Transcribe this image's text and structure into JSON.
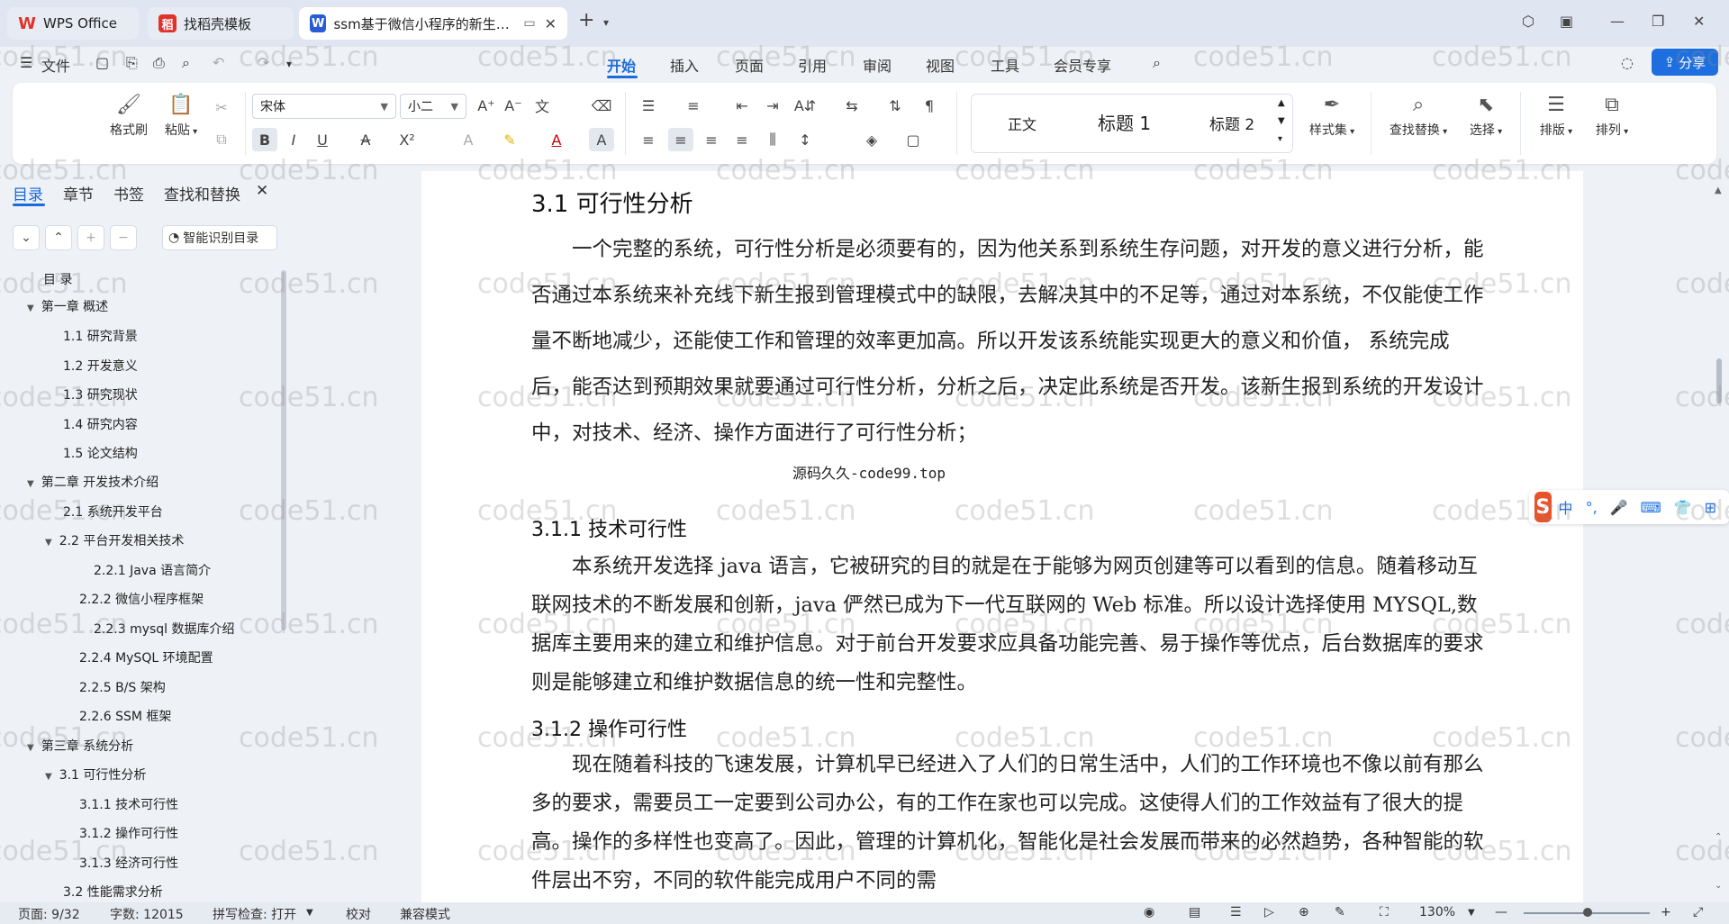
{
  "tabs": [
    {
      "label": "WPS Office",
      "active": false
    },
    {
      "label": "找稻壳模板",
      "active": false
    },
    {
      "label": "ssm基于微信小程序的新生报到",
      "active": true
    }
  ],
  "menu": {
    "file": "文件",
    "tabs": [
      "开始",
      "插入",
      "页面",
      "引用",
      "审阅",
      "视图",
      "工具",
      "会员专享"
    ],
    "active_tab": "开始",
    "share": "分享"
  },
  "ribbon": {
    "format_painter": "格式刷",
    "paste": "粘贴",
    "font_name": "宋体",
    "font_size": "小二",
    "styles": [
      "正文",
      "标题 1",
      "标题 2"
    ],
    "style_set": "样式集",
    "find_replace": "查找替换",
    "select": "选择",
    "layout": "排版",
    "arrange": "排列"
  },
  "left_panel": {
    "tabs": [
      "目录",
      "章节",
      "书签",
      "查找和替换"
    ],
    "active_tab": "目录",
    "smart_toc": "智能识别目录",
    "toc": [
      {
        "label": "目  录",
        "level": 0
      },
      {
        "label": "第一章  概述",
        "level": 1
      },
      {
        "label": "1.1  研究背景",
        "level": 2
      },
      {
        "label": "1.2  开发意义",
        "level": 2
      },
      {
        "label": "1.3  研究现状",
        "level": 2
      },
      {
        "label": "1.4  研究内容",
        "level": 2
      },
      {
        "label": "1.5  论文结构",
        "level": 2
      },
      {
        "label": "第二章  开发技术介绍",
        "level": 1
      },
      {
        "label": "2.1  系统开发平台",
        "level": 2
      },
      {
        "label": "2.2  平台开发相关技术",
        "level": 2
      },
      {
        "label": "2.2.1    Java 语言简介",
        "level": 3
      },
      {
        "label": "2.2.2    微信小程序框架",
        "level": 3
      },
      {
        "label": "2.2.3    mysql 数据库介绍",
        "level": 3
      },
      {
        "label": "2.2.4    MySQL 环境配置",
        "level": 3
      },
      {
        "label": "2.2.5    B/S 架构",
        "level": 3
      },
      {
        "label": "2.2.6    SSM 框架",
        "level": 3
      },
      {
        "label": "第三章  系统分析",
        "level": 1
      },
      {
        "label": "3.1  可行性分析",
        "level": 2
      },
      {
        "label": "3.1.1  技术可行性",
        "level": 3
      },
      {
        "label": "3.1.2  操作可行性",
        "level": 3
      },
      {
        "label": "3.1.3  经济可行性",
        "level": 3
      },
      {
        "label": "3.2  性能需求分析",
        "level": 2
      }
    ]
  },
  "document": {
    "h_3_1": "3.1  可行性分析",
    "p1": "一个完整的系统，可行性分析是必须要有的，因为他关系到系统生存问题，对开发的意义进行分析，能否通过本系统来补充线下新生报到管理模式中的缺限，去解决其中的不足等，通过对本系统，不仅能使工作量不断地减少，还能使工作和管理的效率更加高。所以开发该系统能实现更大的意义和价值，  系统完成后，能否达到预期效果就要通过可行性分析，分析之后，决定此系统是否开发。该新生报到系统的开发设计中，对技术、经济、操作方面进行了可行性分析；",
    "inline_mark": "源码久久-code99.top",
    "h_3_1_1": "3.1.1  技术可行性",
    "p2": "本系统开发选择 java 语言，它被研究的目的就是在于能够为网页创建等可以看到的信息。随着移动互联网技术的不断发展和创新，java 俨然已成为下一代互联网的 Web 标准。所以设计选择使用 MYSQL,数据库主要用来的建立和维护信息。对于前台开发要求应具备功能完善、易于操作等优点，后台数据库的要求则是能够建立和维护数据信息的统一性和完整性。",
    "h_3_1_2": "3.1.2  操作可行性",
    "p3": "现在随着科技的飞速发展，计算机早已经进入了人们的日常生活中，人们的工作环境也不像以前有那么多的要求，需要员工一定要到公司办公，有的工作在家也可以完成。这使得人们的工作效益有了很大的提高。操作的多样性也变高了。因此，管理的计算机化，智能化是社会发展而带来的必然趋势，各种智能的软件层出不穷，不同的软件能完成用户不同的需"
  },
  "ime": {
    "label": "中"
  },
  "status": {
    "page": "页面: 9/32",
    "words": "字数: 12015",
    "spell": "拼写检查: 打开",
    "proof": "校对",
    "compat": "兼容模式",
    "zoom": "130%"
  },
  "watermark": "code51.cn"
}
